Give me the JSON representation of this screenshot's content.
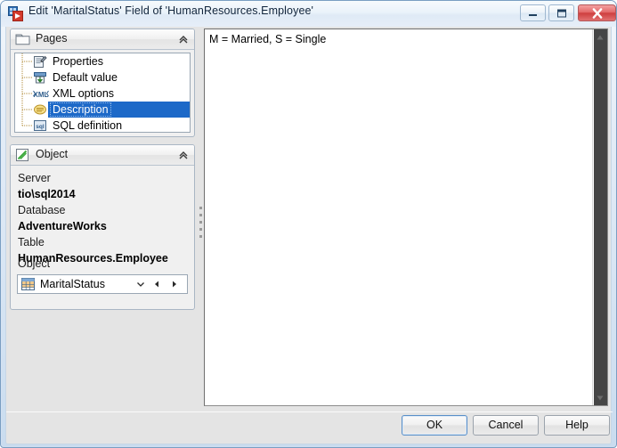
{
  "window": {
    "title": "Edit 'MaritalStatus' Field of 'HumanResources.Employee'",
    "icon": "app-icon",
    "controls": {
      "minimize": "minimize-icon",
      "maximize": "maximize-icon",
      "close": "close-icon"
    },
    "colors": {
      "frame": "#b8cfe5",
      "titlebar": "#eaf2fa",
      "body": "#e4e4e4",
      "selection": "#1d69c8",
      "close_button": "#cf3f3f"
    }
  },
  "pages_panel": {
    "title": "Pages",
    "icon": "folder-icon",
    "collapse_icon": "chevron-up-double-icon",
    "items": [
      {
        "label": "Properties",
        "icon": "properties-document-icon",
        "selected": false
      },
      {
        "label": "Default value",
        "icon": "default-value-table-icon",
        "selected": false
      },
      {
        "label": "XML options",
        "icon": "xml-icon",
        "selected": false
      },
      {
        "label": "Description",
        "icon": "description-oval-icon",
        "selected": true
      },
      {
        "label": "SQL definition",
        "icon": "sql-icon",
        "selected": false
      }
    ]
  },
  "object_panel": {
    "title": "Object",
    "icon": "object-green-icon",
    "collapse_icon": "chevron-up-double-icon",
    "fields": [
      {
        "label": "Server",
        "value": "tio\\sql2014"
      },
      {
        "label": "Database",
        "value": "AdventureWorks"
      },
      {
        "label": "Table",
        "value": "HumanResources.Employee"
      }
    ],
    "object_field_label": "Object",
    "combo": {
      "value": "MaritalStatus",
      "icon": "grid-table-icon",
      "dropdown_icon": "chevron-down-icon",
      "prev_icon": "triangle-left-icon",
      "next_icon": "triangle-right-icon"
    }
  },
  "editor": {
    "text": "M = Married, S = Single",
    "scrollbar": {
      "up_icon": "triangle-up-icon",
      "down_icon": "triangle-down-icon"
    }
  },
  "footer": {
    "ok_label": "OK",
    "cancel_label": "Cancel",
    "help_label": "Help"
  }
}
